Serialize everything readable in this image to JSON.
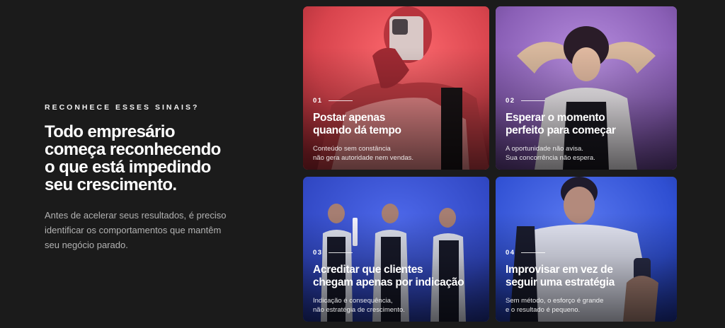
{
  "intro": {
    "eyebrow": "RECONHECE ESSES SINAIS?",
    "headline_lines": [
      "Todo empresário",
      "começa reconhecendo",
      "o que está impedindo",
      "seu crescimento."
    ],
    "lead_lines": [
      "Antes de acelerar seus resultados, é preciso",
      "identificar os comportamentos que mantêm",
      "seu negócio parado."
    ]
  },
  "cards": [
    {
      "number": "01",
      "title_lines": [
        "Postar apenas",
        "quando dá tempo"
      ],
      "desc_lines": [
        "Conteúdo sem constância",
        "não gera autoridade nem vendas."
      ],
      "photo": "man-holding-phone-red-light",
      "tint": "#d8444d"
    },
    {
      "number": "02",
      "title_lines": [
        "Esperar o momento",
        "perfeito para começar"
      ],
      "desc_lines": [
        "A oportunidade não avisa.",
        "Sua concorrência não espera."
      ],
      "photo": "woman-hands-on-head-purple-light",
      "tint": "#8a5fb6"
    },
    {
      "number": "03",
      "title_lines": [
        "Acreditar que clientes",
        "chegam apenas por indicação"
      ],
      "desc_lines": [
        "Indicação é consequência,",
        "não estratégia de crescimento."
      ],
      "photo": "three-people-filming-blue-light",
      "tint": "#3148c4"
    },
    {
      "number": "04",
      "title_lines": [
        "Improvisar em vez de",
        "seguir uma estratégia"
      ],
      "desc_lines": [
        "Sem método, o esforço é grande",
        "e o resultado é pequeno."
      ],
      "photo": "man-looking-at-phone-blue-light",
      "tint": "#2f4fd2"
    }
  ]
}
